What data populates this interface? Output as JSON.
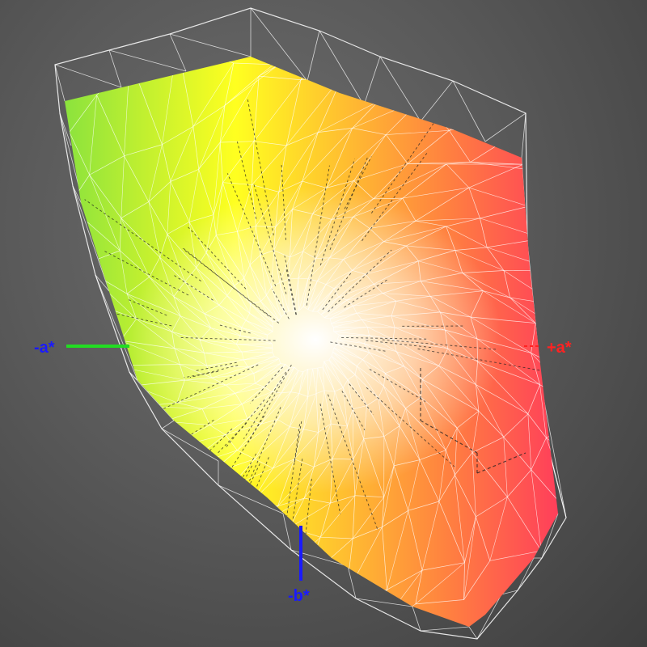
{
  "axes": {
    "neg_a": {
      "label": "-a*",
      "color": "#1a1aff",
      "line_color": "#22dd22"
    },
    "pos_a": {
      "label": "+a*",
      "color": "#ff2222",
      "line_color": "#ff2222"
    },
    "neg_b": {
      "label": "-b*",
      "color": "#1a1aff",
      "line_color": "#1a1aff"
    }
  },
  "colors": {
    "background": "#555555",
    "wireframe": "#ffffff",
    "dashed_wireframe": "#222222",
    "gamut_green": "#80e040",
    "gamut_yellow": "#ffff20",
    "gamut_orange": "#ff8040",
    "gamut_red": "#ff3060",
    "gamut_magenta": "#ff40ff",
    "gamut_purple": "#c060ff",
    "gamut_blue": "#60a0ff",
    "gamut_cyan": "#40ffff",
    "gamut_white": "#ffffff"
  }
}
